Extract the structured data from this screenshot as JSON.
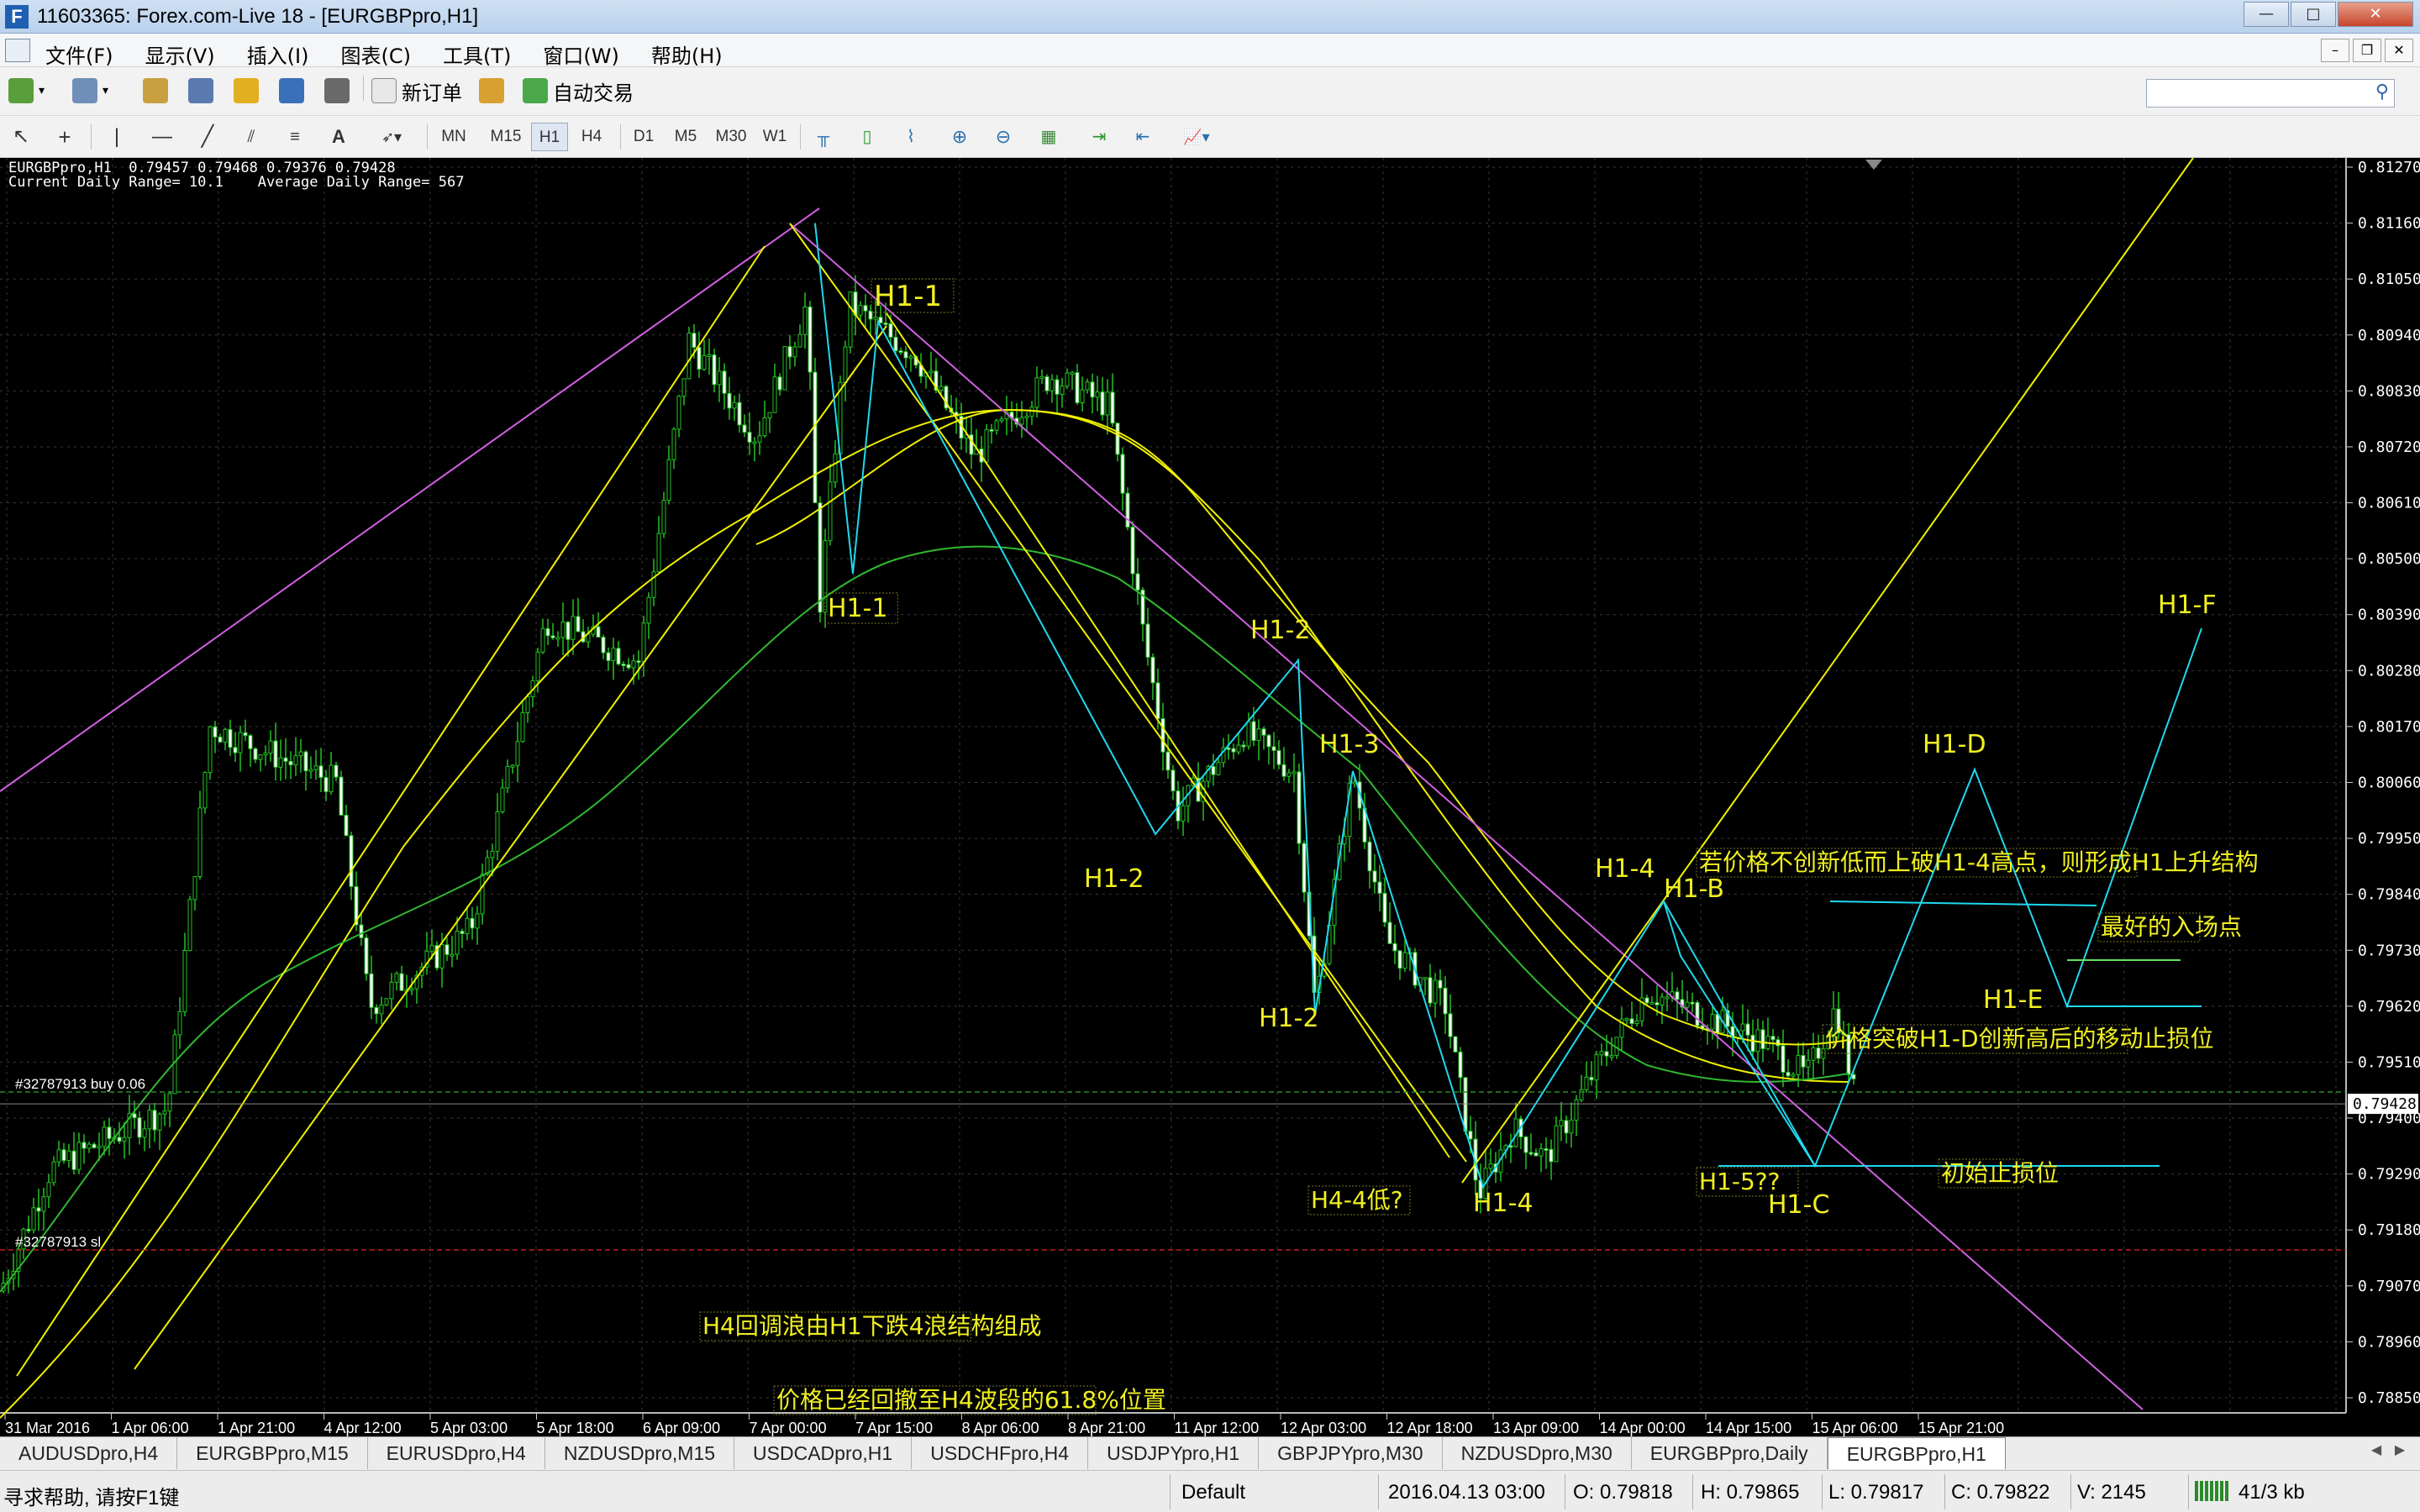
{
  "window": {
    "title": "11603365: Forex.com-Live 18 - [EURGBPpro,H1]",
    "controls": [
      "—",
      "□",
      "✕"
    ]
  },
  "menu": [
    "文件(F)",
    "显示(V)",
    "插入(I)",
    "图表(C)",
    "工具(T)",
    "窗口(W)",
    "帮助(H)"
  ],
  "toolbar": {
    "new_order": "新订单",
    "auto_trading": "自动交易"
  },
  "timeframes": [
    "MN",
    "M15",
    "H1",
    "H4",
    "D1",
    "M5",
    "M30",
    "W1"
  ],
  "selected_timeframe": "H1",
  "chart": {
    "symbol_line": "EURGBPpro,H1  0.79457 0.79468 0.79376 0.79428",
    "range_line": "Current Daily Range= 10.1    Average Daily Range= 567",
    "price_labels": [
      "0.81270",
      "0.81160",
      "0.81050",
      "0.80940",
      "0.80830",
      "0.80720",
      "0.80610",
      "0.80500",
      "0.80390",
      "0.80280",
      "0.80170",
      "0.80060",
      "0.79950",
      "0.79840",
      "0.79730",
      "0.79620",
      "0.79510",
      "0.79400",
      "0.79290",
      "0.79180",
      "0.79070",
      "0.78960",
      "0.78850"
    ],
    "current_price": "0.79428",
    "time_labels": [
      "31 Mar 2016",
      "1 Apr 06:00",
      "1 Apr 21:00",
      "4 Apr 12:00",
      "5 Apr 03:00",
      "5 Apr 18:00",
      "6 Apr 09:00",
      "7 Apr 00:00",
      "7 Apr 15:00",
      "8 Apr 06:00",
      "8 Apr 21:00",
      "11 Apr 12:00",
      "12 Apr 03:00",
      "12 Apr 18:00",
      "13 Apr 09:00",
      "14 Apr 00:00",
      "14 Apr 15:00",
      "15 Apr 06:00",
      "15 Apr 21:00"
    ],
    "order_labels": {
      "buy": "#32787913 buy 0.06",
      "sl": "#32787913 sl"
    },
    "annotations": {
      "h1_1_top": "H1-1",
      "h1_1_bottom": "H1-1",
      "h1_2_a": "H1-2",
      "h1_2_b": "H1-2",
      "h1_2_c": "H1-2",
      "h1_3": "H1-3",
      "h1_4_a": "H1-4",
      "h1_4_b": "H1-4",
      "h1_5": "H1-5??",
      "h1_b": "H1-B",
      "h1_c": "H1-C",
      "h1_d": "H1-D",
      "h1_e": "H1-E",
      "h1_f": "H1-F",
      "h4_low": "H4-4低?",
      "note_structure": "若价格不创新低而上破H1-4高点，则形成H1上升结构",
      "note_entry": "最好的入场点",
      "note_trailing": "价格突破H1-D创新高后的移动止损位",
      "note_initial_stop": "初始止损位",
      "note_h4_retrace": "H4回调浪由H1下跌4浪结构组成",
      "note_618": "价格已经回撤至H4波段的61.8%位置"
    },
    "colors": {
      "background": "#000000",
      "grid": "#3a3a3a",
      "candle": "#22c022",
      "ma_yellow": "#f0f000",
      "ma_green": "#2fb92f",
      "trend_magenta": "#d060e0",
      "wave_cyan": "#20d8ee",
      "label_yellow": "#f0f020"
    }
  },
  "tabs": [
    "AUDUSDpro,H4",
    "EURGBPpro,M15",
    "EURUSDpro,H4",
    "NZDUSDpro,M15",
    "USDCADpro,H1",
    "USDCHFpro,H4",
    "USDJPYpro,H1",
    "GBPJPYpro,M30",
    "NZDUSDpro,M30",
    "EURGBPpro,Daily",
    "EURGBPpro,H1"
  ],
  "active_tab": "EURGBPpro,H1",
  "status": {
    "help": "寻求帮助, 请按F1键",
    "profile": "Default",
    "datetime": "2016.04.13 03:00",
    "open": "O: 0.79818",
    "high": "H: 0.79865",
    "low": "L: 0.79817",
    "close": "C: 0.79822",
    "volume": "V: 2145",
    "traffic": "41/3 kb"
  }
}
